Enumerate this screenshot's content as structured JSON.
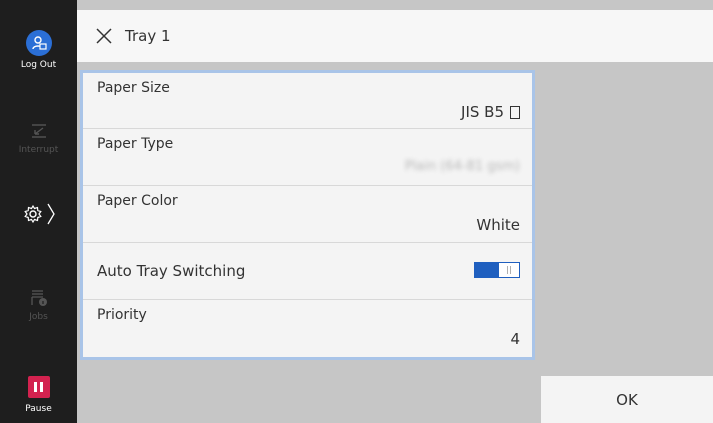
{
  "sidebar": {
    "logout_label": "Log Out",
    "interrupt_label": "Interrupt",
    "jobs_label": "Jobs",
    "pause_label": "Pause"
  },
  "header": {
    "title": "Tray 1"
  },
  "settings": {
    "paper_size": {
      "label": "Paper Size",
      "value": "JIS B5"
    },
    "paper_type": {
      "label": "Paper Type",
      "value": "Plain (64-81 gsm)"
    },
    "paper_color": {
      "label": "Paper Color",
      "value": "White"
    },
    "auto_tray_switching": {
      "label": "Auto Tray Switching",
      "enabled": true
    },
    "priority": {
      "label": "Priority",
      "value": "4"
    }
  },
  "footer": {
    "ok_label": "OK"
  },
  "colors": {
    "sidebar_bg": "#1e1e1e",
    "accent_blue": "#1f5fbf",
    "pause_red": "#d3224f",
    "panel_border": "#a9c4e8"
  }
}
